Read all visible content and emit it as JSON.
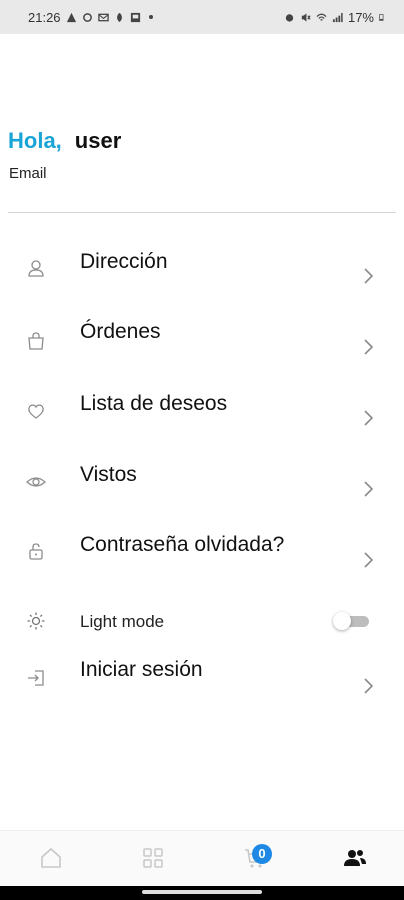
{
  "status_bar": {
    "time": "21:26",
    "battery": "17%",
    "icons_left": [
      "warning-icon",
      "sync-icon",
      "mail-icon",
      "leaf-icon",
      "image-icon"
    ],
    "icons_right": [
      "alarm-icon",
      "mute-icon",
      "wifi-icon",
      "signal-icon",
      "battery-icon"
    ]
  },
  "header": {
    "greeting": "Hola,",
    "username": "user",
    "email_label": "Email"
  },
  "menu": {
    "items": [
      {
        "label": "Dirección",
        "icon": "user-icon"
      },
      {
        "label": "Órdenes",
        "icon": "shopping-bag-icon"
      },
      {
        "label": "Lista de deseos",
        "icon": "heart-icon"
      },
      {
        "label": "Vistos",
        "icon": "eye-icon"
      },
      {
        "label": "Contraseña olvidada?",
        "icon": "lock-icon"
      }
    ],
    "light_mode": {
      "label": "Light mode",
      "icon": "sun-icon",
      "enabled": false
    },
    "login": {
      "label": "Iniciar sesión",
      "icon": "login-icon"
    }
  },
  "bottom_nav": {
    "items": [
      "home-icon",
      "grid-icon",
      "cart-icon",
      "account-icon"
    ],
    "cart_count": "0",
    "active": "account-icon",
    "active_color": "#111111",
    "inactive_color": "#c8c8c8"
  },
  "colors": {
    "accent": "#1ba4d6",
    "badge": "#1e88e5"
  }
}
